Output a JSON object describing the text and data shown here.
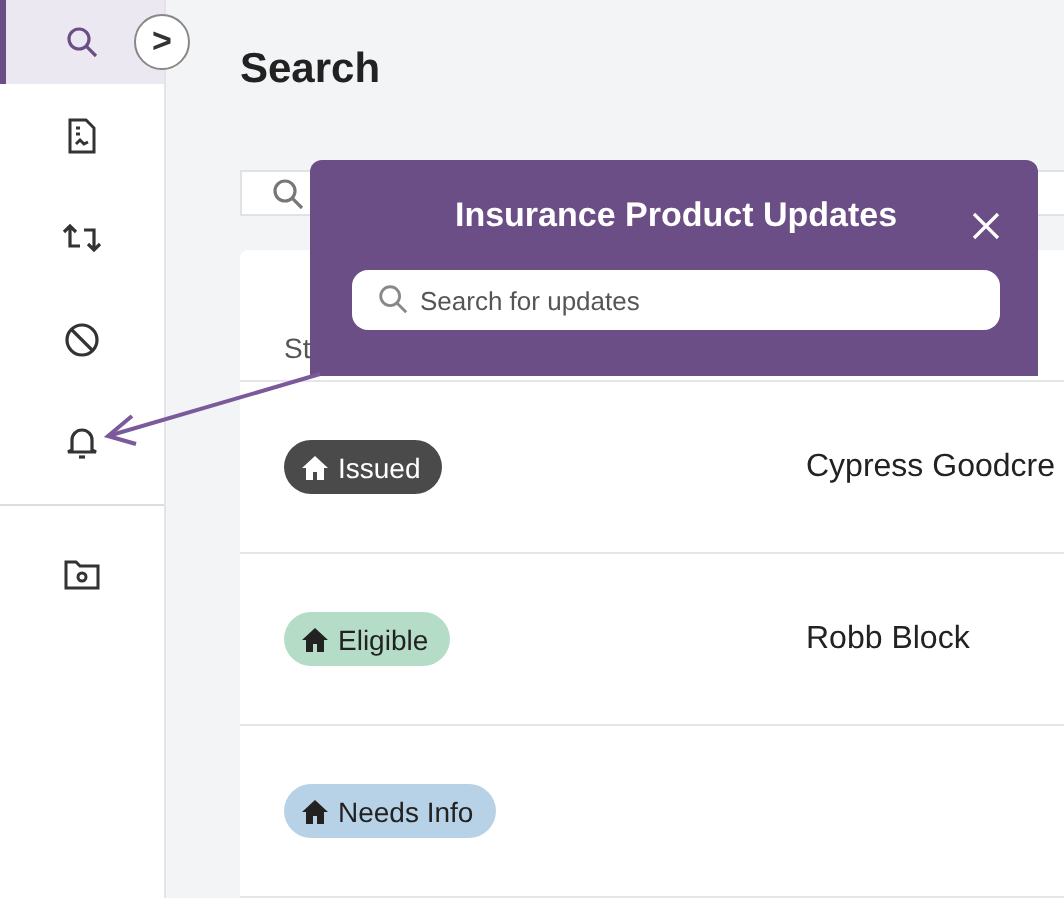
{
  "sidebar": {
    "items": [
      {
        "kind": "search",
        "selected": true
      },
      {
        "kind": "document",
        "selected": false
      },
      {
        "kind": "swap",
        "selected": false
      },
      {
        "kind": "block",
        "selected": false
      },
      {
        "kind": "bell",
        "selected": false
      },
      {
        "kind": "folder",
        "selected": false
      }
    ],
    "expand_button": ">"
  },
  "page": {
    "title": "Search"
  },
  "table": {
    "columns": [
      "St"
    ],
    "rows": [
      {
        "status": "Issued",
        "color": "#4a4a4a",
        "applicant": "Cypress Goodcre"
      },
      {
        "status": "Eligible",
        "color": "#b5dcc6",
        "applicant": "Robb Block"
      },
      {
        "status": "Needs Info",
        "color": "#b7d2e6"
      }
    ]
  },
  "popup": {
    "title": "Insurance Product Updates",
    "search": {
      "placeholder": "Search for updates"
    }
  }
}
